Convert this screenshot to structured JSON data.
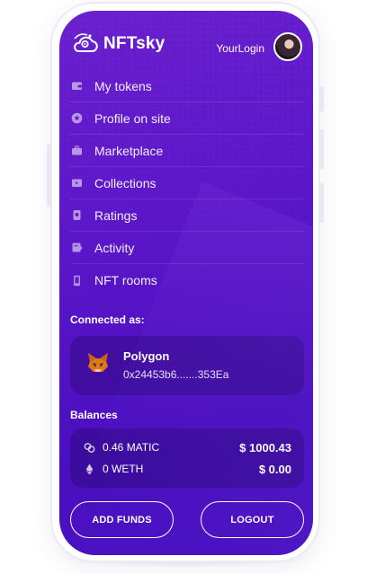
{
  "header": {
    "brand": "NFTsky",
    "login_label": "YourLogin"
  },
  "menu": {
    "items": [
      {
        "label": "My tokens",
        "icon": "wallet-icon"
      },
      {
        "label": "Profile on site",
        "icon": "star-badge-icon"
      },
      {
        "label": "Marketplace",
        "icon": "briefcase-icon"
      },
      {
        "label": "Collections",
        "icon": "folder-icon"
      },
      {
        "label": "Ratings",
        "icon": "medal-icon"
      },
      {
        "label": "Activity",
        "icon": "activity-icon"
      },
      {
        "label": "NFT rooms",
        "icon": "phone-icon"
      }
    ]
  },
  "connected": {
    "title": "Connected as:",
    "network": "Polygon",
    "address": "0x24453b6.......353Ea",
    "wallet_icon": "metamask-fox-icon"
  },
  "balances": {
    "title": "Balances",
    "rows": [
      {
        "amount": "0.46 MATIC",
        "usd": "$ 1000.43",
        "icon": "matic-icon"
      },
      {
        "amount": "0 WETH",
        "usd": "$ 0.00",
        "icon": "eth-icon"
      }
    ]
  },
  "actions": {
    "add_funds": "ADD FUNDS",
    "logout": "LOGOUT"
  },
  "colors": {
    "screen_bg_top": "#6a20ce",
    "screen_bg_bottom": "#4b13c4",
    "card_bg": "#3a0b8a",
    "text": "#ffffff"
  }
}
